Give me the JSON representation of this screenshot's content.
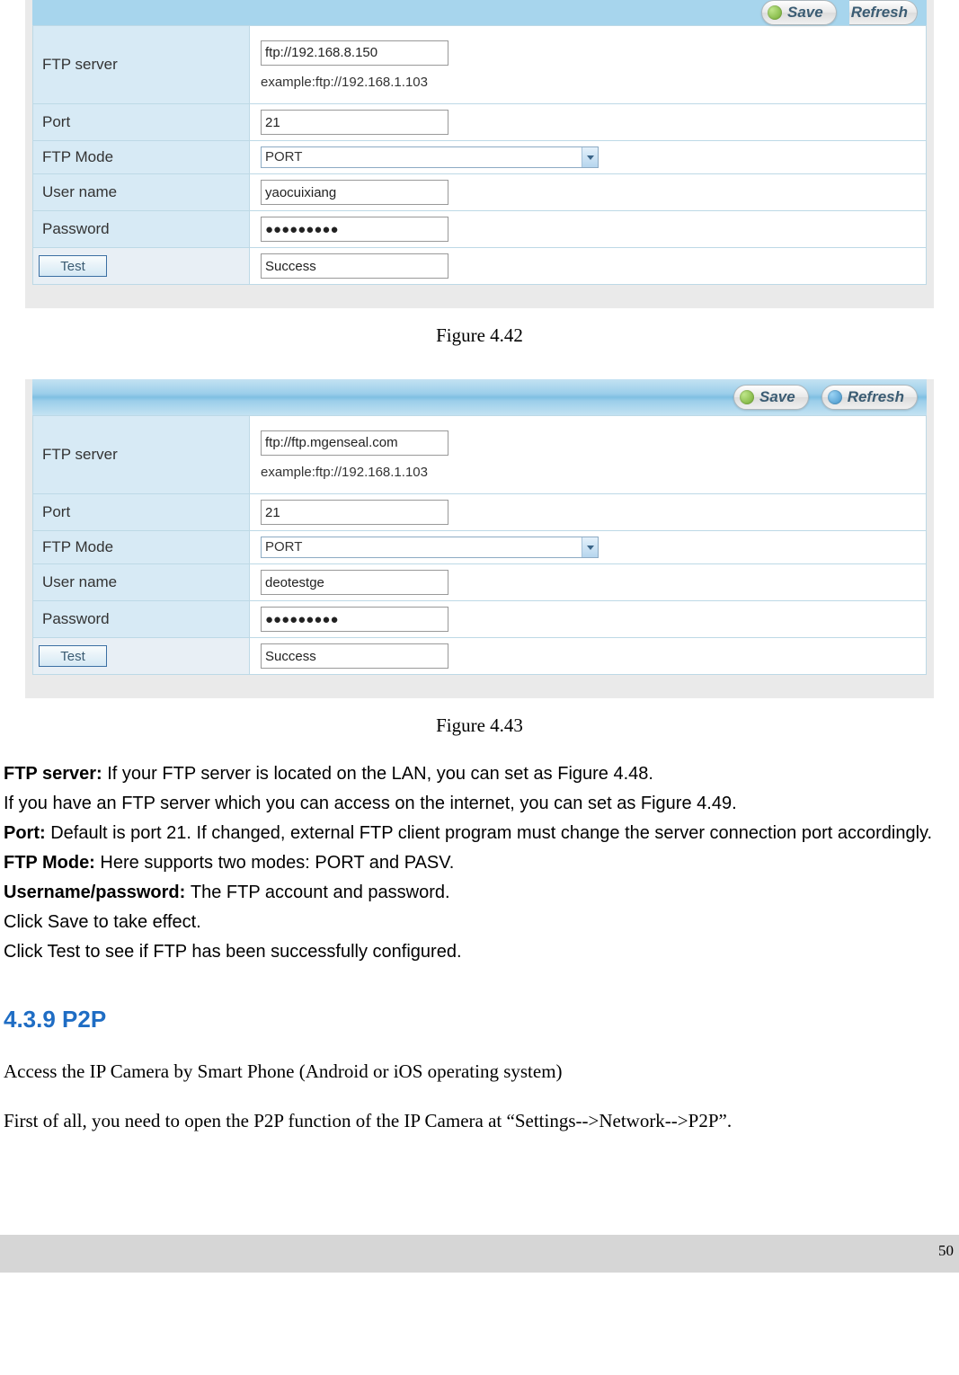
{
  "buttons": {
    "save": "Save",
    "refresh": "Refresh",
    "test": "Test"
  },
  "labels": {
    "ftp_server": "FTP server",
    "port": "Port",
    "ftp_mode": "FTP Mode",
    "user_name": "User name",
    "password": "Password"
  },
  "fig42": {
    "ftp_server": "ftp://192.168.8.150",
    "example": "example:ftp://192.168.1.103",
    "port": "21",
    "ftp_mode": "PORT",
    "user_name": "yaocuixiang",
    "password": "●●●●●●●●●",
    "status": "Success",
    "caption": "Figure 4.42"
  },
  "fig43": {
    "ftp_server": "ftp://ftp.mgenseal.com",
    "example": "example:ftp://192.168.1.103",
    "port": "21",
    "ftp_mode": "PORT",
    "user_name": "deotestge",
    "password": "●●●●●●●●●",
    "status": "Success",
    "caption": "Figure 4.43"
  },
  "doc": {
    "p1a": "FTP server: ",
    "p1b": "If your FTP server is located on the LAN, you can set as Figure 4.48.",
    "p2": "If you have an FTP server which you can access on the internet, you can set as Figure 4.49.",
    "p3a": "Port: ",
    "p3b": "Default is port 21. If changed, external FTP client program must change the server connection port accordingly.",
    "p4a": "FTP Mode: ",
    "p4b": "Here supports two modes: PORT and PASV.",
    "p5a": "Username/password: ",
    "p5b": "The FTP account and password.",
    "p6": "Click Save to take effect.",
    "p7": "Click Test to see if FTP has been successfully configured."
  },
  "section": "4.3.9 P2P",
  "serif": {
    "s1": "Access the IP Camera by Smart Phone (Android or iOS operating system)",
    "s2": "First of all, you need to open the P2P function of the IP Camera at “Settings-->Network-->P2P”."
  },
  "page_number": "50"
}
